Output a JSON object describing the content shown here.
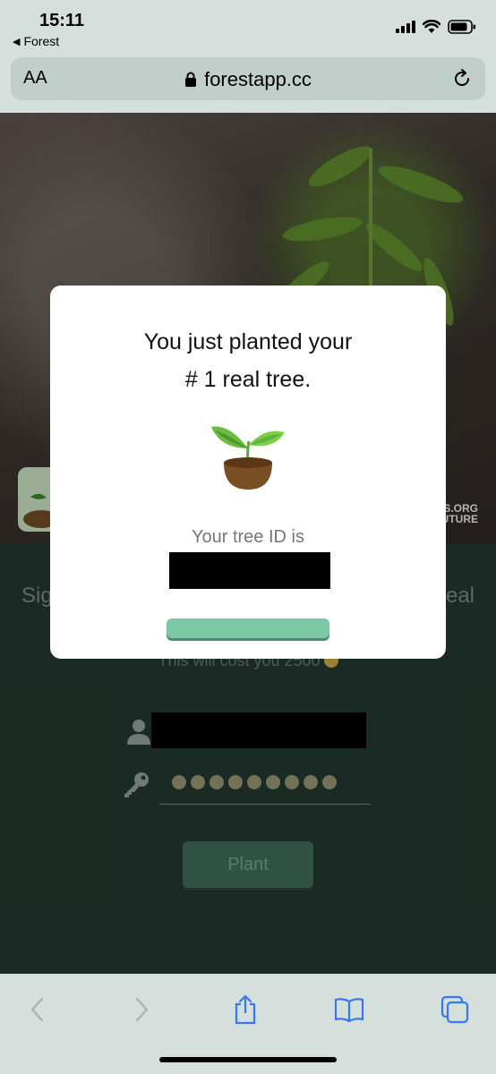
{
  "status_bar": {
    "time": "15:11",
    "back_label": "Forest"
  },
  "browser": {
    "text_size_label": "AA",
    "domain": "forestapp.cc"
  },
  "page": {
    "signin_left_fragment": "Sig",
    "signin_right_fragment": "eal",
    "cost_text": "This will cost you 2500",
    "plant_button_label": "Plant",
    "trees_logo_line1": "EES.ORG",
    "trees_logo_line2": "UTURE"
  },
  "modal": {
    "title_line1": "You just planted your",
    "title_line2": "# 1 real tree.",
    "id_label": "Your tree ID is"
  },
  "colors": {
    "accent_green": "#7cc7a5",
    "dark_green_bg": "#20342c",
    "browser_chrome": "#d5e0dc",
    "ios_blue": "#3478f6"
  }
}
